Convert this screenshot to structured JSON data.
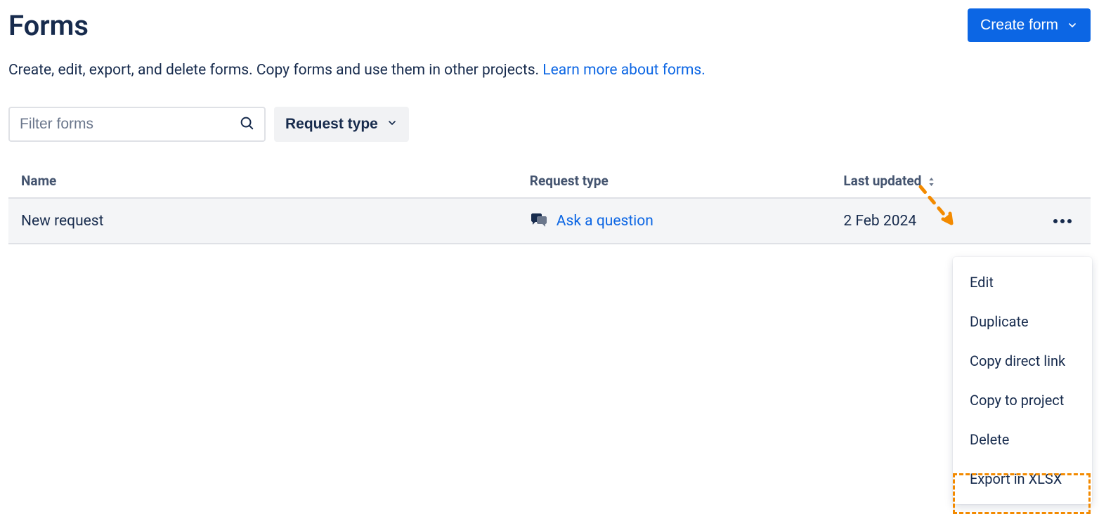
{
  "header": {
    "title": "Forms",
    "create_button_label": "Create form"
  },
  "description": {
    "text": "Create, edit, export, and delete forms. Copy forms and use them in other projects. ",
    "link_text": "Learn more about forms."
  },
  "filters": {
    "search_placeholder": "Filter forms",
    "request_type_label": "Request type"
  },
  "table": {
    "columns": {
      "name": "Name",
      "request_type": "Request type",
      "last_updated": "Last updated"
    },
    "rows": [
      {
        "name": "New request",
        "request_type": "Ask a question",
        "last_updated": "2 Feb 2024"
      }
    ]
  },
  "menu": {
    "items": [
      {
        "label": "Edit"
      },
      {
        "label": "Duplicate"
      },
      {
        "label": "Copy direct link"
      },
      {
        "label": "Copy to project"
      },
      {
        "label": "Delete"
      },
      {
        "label": "Export in XLSX"
      }
    ]
  }
}
